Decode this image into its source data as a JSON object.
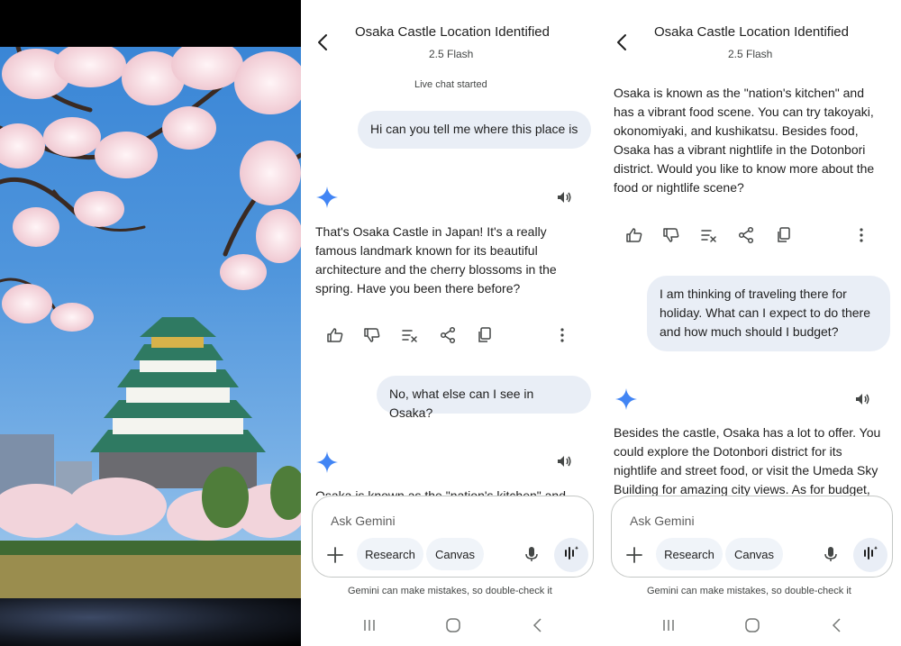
{
  "photo": {
    "subject_icon": "osaka-castle-photo"
  },
  "chat1": {
    "header": {
      "title": "Osaka Castle Location Identified",
      "model": "2.5 Flash",
      "back_icon": "arrow-left-icon"
    },
    "live_note": "Live chat started",
    "messages": [
      {
        "role": "user",
        "text": "Hi can you tell me where this place is"
      },
      {
        "role": "model",
        "lines": [
          "That's Osaka Castle in Japan! It's a really",
          "famous landmark known for its beautiful",
          "architecture and the cherry blossoms in the",
          "spring. Have you been there before?"
        ]
      },
      {
        "role": "user",
        "text": "No, what else can I see in Osaka?"
      },
      {
        "role": "model",
        "partial": "Osaka is known as the \"nation's kitchen\" and"
      }
    ]
  },
  "chat2": {
    "header": {
      "title": "Osaka Castle Location Identified",
      "model": "2.5 Flash",
      "back_icon": "arrow-left-icon"
    },
    "messages": [
      {
        "role": "model",
        "lines": [
          "Osaka is known as the \"nation's kitchen\" and",
          "has a vibrant food scene. You can try takoyaki,",
          "okonomiyaki, and kushikatsu. Besides food,",
          "Osaka has a vibrant nightlife in the Dotonbori",
          "district. Would you like to know more about the",
          "food or nightlife scene?"
        ]
      },
      {
        "role": "user",
        "lines": [
          "I am thinking of traveling there for",
          "holiday. What can I expect to do there",
          "and how much should I budget?"
        ]
      },
      {
        "role": "model",
        "lines": [
          "Besides the castle, Osaka has a lot to offer. You",
          "could explore the Dotonbori district for its",
          "nightlife and street food, or visit the Umeda Sky",
          "Building for amazing city views.  As for budget,"
        ]
      }
    ]
  },
  "composer": {
    "placeholder": "Ask Gemini",
    "research_label": "Research",
    "canvas_label": "Canvas"
  },
  "disclaimer": "Gemini can make mistakes, so double-check it",
  "icons": {
    "like": "thumbs-up-icon",
    "dislike": "thumbs-down-icon",
    "modify": "modify-response-icon",
    "share": "share-icon",
    "copy": "copy-icon",
    "more": "more-vertical-icon",
    "speaker": "speaker-icon",
    "gemini": "gemini-sparkle-icon",
    "mic": "mic-icon",
    "live": "live-audio-icon",
    "plus": "plus-icon"
  },
  "colors": {
    "user_bubble": "#e9eef6",
    "gemini_blue": "#4285f4",
    "chip_bg": "#f0f4f9",
    "text": "#1f1f1f"
  }
}
